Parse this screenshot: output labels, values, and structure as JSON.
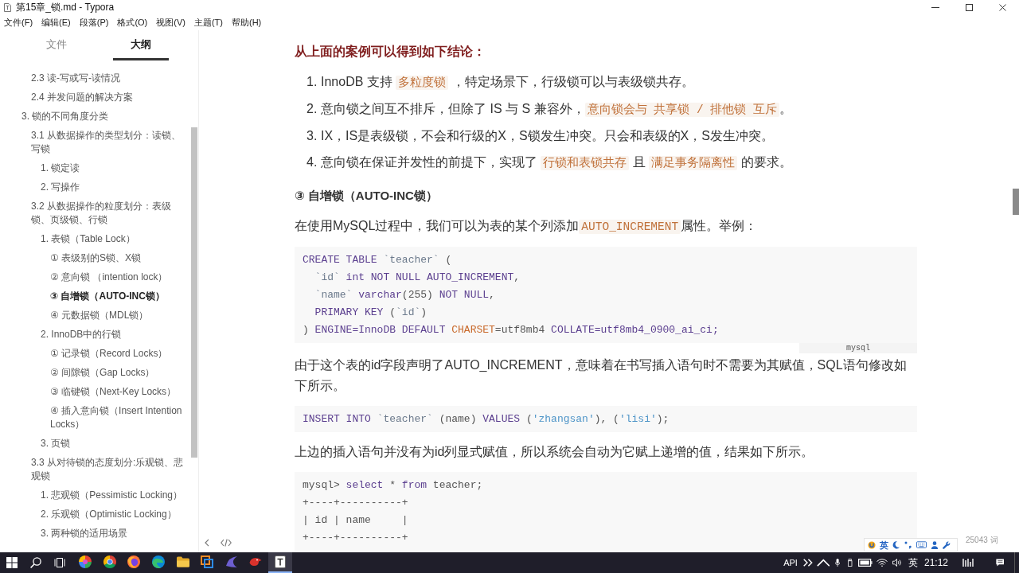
{
  "window": {
    "title": "第15章_锁.md - Typora"
  },
  "menu": [
    "文件(F)",
    "编辑(E)",
    "段落(P)",
    "格式(O)",
    "视图(V)",
    "主题(T)",
    "帮助(H)"
  ],
  "sidebar": {
    "tabs": [
      {
        "label": "文件",
        "selected": false
      },
      {
        "label": "大纲",
        "selected": true
      }
    ],
    "outline": [
      {
        "children": [
          {
            "label": "2.3 读-写或写-读情况",
            "selected": false
          },
          {
            "label": "2.4 并发问题的解决方案",
            "selected": false
          }
        ]
      },
      {
        "label": "3. 锁的不同角度分类",
        "selected": false,
        "children": [
          {
            "label": "3.1 从数据操作的类型划分：读锁、写锁",
            "selected": false,
            "children": [
              {
                "label": "1. 锁定读",
                "selected": false
              },
              {
                "label": "2. 写操作",
                "selected": false
              }
            ]
          },
          {
            "label": "3.2 从数据操作的粒度划分：表级锁、页级锁、行锁",
            "selected": false,
            "children": [
              {
                "label": "1. 表锁（Table Lock）",
                "selected": false,
                "children": [
                  {
                    "label": "① 表级别的S锁、X锁",
                    "selected": false
                  },
                  {
                    "label": "② 意向锁 （intention lock）",
                    "selected": false
                  },
                  {
                    "label": "③ 自增锁（AUTO-INC锁）",
                    "selected": true
                  },
                  {
                    "label": "④ 元数据锁（MDL锁）",
                    "selected": false
                  }
                ]
              },
              {
                "label": "2. InnoDB中的行锁",
                "selected": false,
                "children": [
                  {
                    "label": "① 记录锁（Record Locks）",
                    "selected": false
                  },
                  {
                    "label": "② 间隙锁（Gap Locks）",
                    "selected": false
                  },
                  {
                    "label": "③ 临键锁（Next-Key Locks）",
                    "selected": false
                  },
                  {
                    "label": "④ 插入意向锁（Insert Intention Locks）",
                    "selected": false
                  }
                ]
              },
              {
                "label": "3. 页锁",
                "selected": false
              }
            ]
          },
          {
            "label": "3.3 从对待锁的态度划分:乐观锁、悲观锁",
            "selected": false,
            "children": [
              {
                "label": "1. 悲观锁（Pessimistic Locking）",
                "selected": false
              },
              {
                "label": "2. 乐观锁（Optimistic Locking）",
                "selected": false
              },
              {
                "label": "3. 两种锁的适用场景",
                "selected": false
              }
            ]
          }
        ]
      }
    ]
  },
  "editor": {
    "blocks": [
      {
        "kind": "strong_heading",
        "text": "从上面的案例可以得到如下结论："
      },
      {
        "kind": "ordered_list",
        "items": [
          {
            "number": "1.",
            "segments": [
              {
                "kind": "text",
                "text": "InnoDB 支持 "
              },
              {
                "kind": "code",
                "text": "多粒度锁"
              },
              {
                "kind": "text",
                "text": " ，特定场景下，行级锁可以与表级锁共存。"
              }
            ]
          },
          {
            "number": "2.",
            "segments": [
              {
                "kind": "text",
                "text": "意向锁之间互不排斥，但除了 IS 与 S 兼容外，"
              },
              {
                "kind": "code",
                "text": "意向锁会与 共享锁 / 排他锁 互斥"
              },
              {
                "kind": "text",
                "text": "。"
              }
            ]
          },
          {
            "number": "3.",
            "segments": [
              {
                "kind": "text",
                "text": "IX，IS是表级锁，不会和行级的X，S锁发生冲突。只会和表级的X，S发生冲突。"
              }
            ]
          },
          {
            "number": "4.",
            "segments": [
              {
                "kind": "text",
                "text": "意向锁在保证并发性的前提下，实现了 "
              },
              {
                "kind": "code",
                "text": "行锁和表锁共存"
              },
              {
                "kind": "text",
                "text": " 且 "
              },
              {
                "kind": "code",
                "text": "满足事务隔离性"
              },
              {
                "kind": "text",
                "text": " 的要求。"
              }
            ]
          }
        ]
      },
      {
        "kind": "heading",
        "text": "③ 自增锁（AUTO-INC锁）"
      },
      {
        "kind": "paragraph",
        "segments": [
          {
            "kind": "text",
            "text": "在使用MySQL过程中，我们可以为表的某个列添加"
          },
          {
            "kind": "code",
            "text": "AUTO_INCREMENT"
          },
          {
            "kind": "text",
            "text": "属性。举例："
          }
        ]
      },
      {
        "kind": "code",
        "language": "mysql",
        "lines": [
          {
            "tokens": [
              {
                "kind": "keyword",
                "text": "CREATE TABLE"
              },
              {
                "kind": "name",
                "text": " `teacher`"
              },
              {
                "kind": "plain",
                "text": " ("
              }
            ]
          },
          {
            "tokens": [
              {
                "kind": "name",
                "text": "  `id`"
              },
              {
                "kind": "keyword",
                "text": " int NOT NULL AUTO_INCREMENT"
              },
              {
                "kind": "plain",
                "text": ","
              }
            ]
          },
          {
            "tokens": [
              {
                "kind": "name",
                "text": "  `name`"
              },
              {
                "kind": "keyword",
                "text": " varchar"
              },
              {
                "kind": "plain",
                "text": "(255) "
              },
              {
                "kind": "keyword",
                "text": "NOT NULL"
              },
              {
                "kind": "plain",
                "text": ","
              }
            ]
          },
          {
            "tokens": [
              {
                "kind": "keyword",
                "text": "  PRIMARY KEY"
              },
              {
                "kind": "plain",
                "text": " ("
              },
              {
                "kind": "name",
                "text": "`id`"
              },
              {
                "kind": "plain",
                "text": ")"
              }
            ]
          },
          {
            "tokens": [
              {
                "kind": "plain",
                "text": ") "
              },
              {
                "kind": "keyword",
                "text": "ENGINE=InnoDB DEFAULT"
              },
              {
                "kind": "builtin",
                "text": " CHARSET"
              },
              {
                "kind": "plain",
                "text": "=utf8mb4 "
              },
              {
                "kind": "keyword",
                "text": "COLLATE=utf8mb4_0900_ai_ci;"
              }
            ]
          }
        ]
      },
      {
        "kind": "paragraph",
        "segments": [
          {
            "kind": "text",
            "text": "由于这个表的id字段声明了AUTO_INCREMENT，意味着在书写插入语句时不需要为其赋值，SQL语句修改如下所示。"
          }
        ]
      },
      {
        "kind": "code",
        "lines": [
          {
            "tokens": [
              {
                "kind": "keyword",
                "text": "INSERT INTO"
              },
              {
                "kind": "name",
                "text": " `teacher`"
              },
              {
                "kind": "plain",
                "text": " (name) "
              },
              {
                "kind": "keyword",
                "text": "VALUES"
              },
              {
                "kind": "plain",
                "text": " ("
              },
              {
                "kind": "string",
                "text": "'zhangsan'"
              },
              {
                "kind": "plain",
                "text": "), ("
              },
              {
                "kind": "string",
                "text": "'lisi'"
              },
              {
                "kind": "plain",
                "text": ");"
              }
            ]
          }
        ]
      },
      {
        "kind": "paragraph",
        "segments": [
          {
            "kind": "text",
            "text": "上边的插入语句并没有为id列显式赋值，所以系统会自动为它赋上递增的值，结果如下所示。"
          }
        ]
      },
      {
        "kind": "code",
        "lines": [
          {
            "tokens": [
              {
                "kind": "plain",
                "text": "mysql> "
              },
              {
                "kind": "keyword",
                "text": "select"
              },
              {
                "kind": "plain",
                "text": " * "
              },
              {
                "kind": "keyword",
                "text": "from"
              },
              {
                "kind": "plain",
                "text": " teacher;"
              }
            ]
          },
          {
            "tokens": [
              {
                "kind": "plain",
                "text": "+----+----------+"
              }
            ]
          },
          {
            "tokens": [
              {
                "kind": "plain",
                "text": "| id | name     |"
              }
            ]
          },
          {
            "tokens": [
              {
                "kind": "plain",
                "text": "+----+----------+"
              }
            ]
          }
        ]
      }
    ],
    "word_count": "25043 词"
  },
  "ime_toolbar": {
    "mode": "英"
  },
  "taskbar": {
    "apps": [
      {
        "kind": "ball",
        "selected": false
      },
      {
        "kind": "wheel",
        "selected": false
      },
      {
        "kind": "fox",
        "selected": false
      },
      {
        "kind": "wave",
        "selected": false
      },
      {
        "kind": "folder",
        "selected": false
      },
      {
        "kind": "squares",
        "selected": false
      },
      {
        "kind": "swoosh",
        "selected": false
      },
      {
        "kind": "bird",
        "selected": false
      },
      {
        "kind": "page",
        "selected": true
      }
    ],
    "tray": {
      "label": "API",
      "input_mode": "英",
      "time": "21:12"
    }
  }
}
